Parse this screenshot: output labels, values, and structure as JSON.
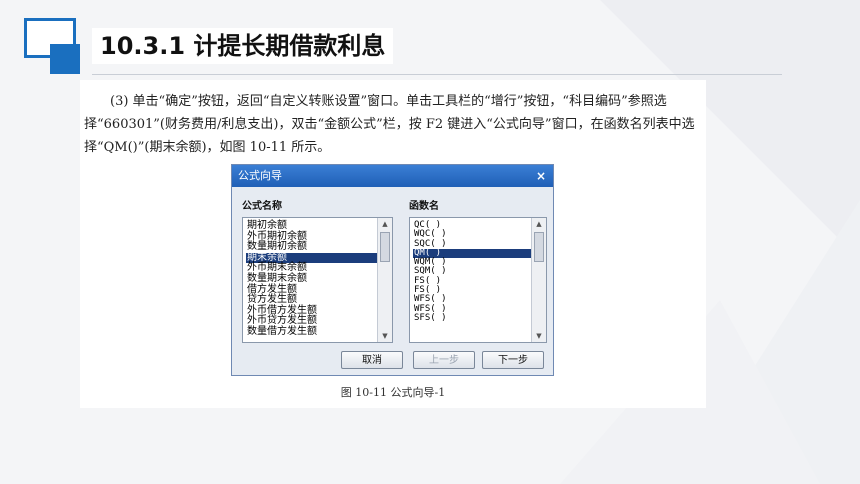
{
  "slide": {
    "title": "10.3.1  计提长期借款利息"
  },
  "document": {
    "paragraph": "(3) 单击“确定”按钮，返回“自定义转账设置”窗口。单击工具栏的“增行”按钮，“科目编码”参照选择“660301”(财务费用/利息支出)，双击“金额公式”栏，按 F2 键进入“公式向导”窗口，在函数名列表中选择“QM()”(期末余额)，如图 10-11 所示。",
    "caption": "图 10-11  公式向导-1"
  },
  "dialog": {
    "title": "公式向导",
    "close_glyph": "×",
    "formula_label": "公式名称",
    "function_label": "函数名",
    "formula_items": [
      "期初余额",
      "外币期初余额",
      "数量期初余额",
      "期末余额",
      "外币期末余额",
      "数量期末余额",
      "借方发生额",
      "贷方发生额",
      "外币借方发生额",
      "外币贷方发生额",
      "数量借方发生额"
    ],
    "function_items": [
      "QC( )",
      "WQC( )",
      "SQC( )",
      "QM( )",
      "WQM( )",
      "SQM( )",
      "FS( )",
      "FS( )",
      "WFS( )",
      "WFS( )",
      "SFS( )"
    ],
    "selected_index": 3,
    "buttons": {
      "cancel": "取消",
      "prev": "上一步",
      "next": "下一步"
    }
  },
  "colors": {
    "accent": "#1a6fbf",
    "selection": "#1b3d7c"
  }
}
